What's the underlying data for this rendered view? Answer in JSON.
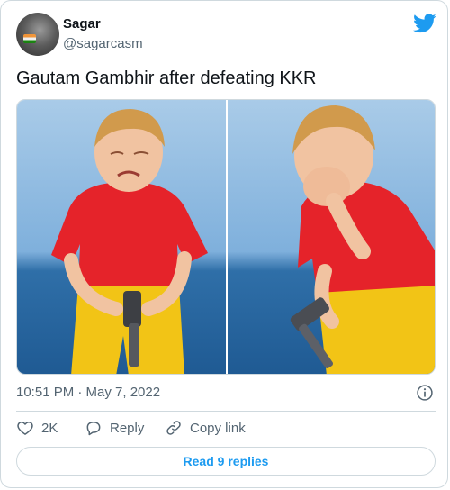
{
  "author": {
    "name": "Sagar",
    "handle": "@sagarcasm"
  },
  "tweet": {
    "text": "Gautam Gambhir after defeating KKR",
    "timestamp": "10:51 PM · May 7, 2022"
  },
  "media": {
    "description_icon": "image-photo",
    "panels": 2
  },
  "actions": {
    "like_count": "2K",
    "reply_label": "Reply",
    "copy_link_label": "Copy link"
  },
  "read_replies_label": "Read 9 replies",
  "icons": {
    "logo": "twitter-bird-icon",
    "info": "info-icon",
    "like": "heart-icon",
    "reply": "speech-bubble-icon",
    "copy": "link-icon"
  },
  "colors": {
    "brand": "#1d9bf0",
    "text": "#0f1419",
    "secondary": "#536471",
    "border": "#cfd9de"
  }
}
